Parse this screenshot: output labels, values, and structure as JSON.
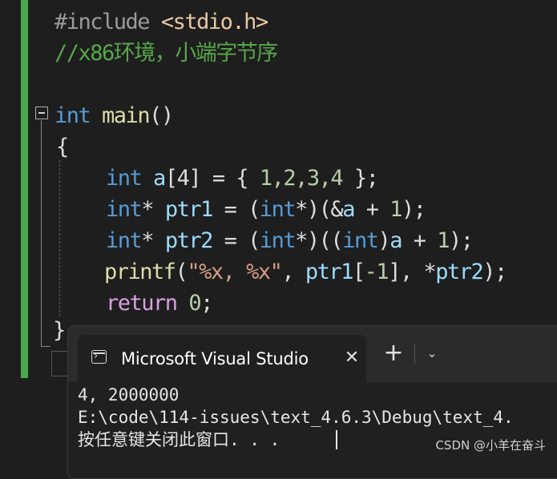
{
  "editor": {
    "line1": {
      "directive": "#include",
      "header": "<stdio.h>"
    },
    "line2": {
      "comment": "//x86环境，小端字节序"
    },
    "line4": {
      "type": "int",
      "name": "main",
      "parens": "()"
    },
    "line5": {
      "brace": "{"
    },
    "line6": {
      "type": "int",
      "var": "a",
      "rest": "[4] = { ",
      "nums": "1,2,3,4",
      "end": " };"
    },
    "line7": {
      "type": "int",
      "ptr": "*",
      "var": "ptr1",
      "eq": " = (",
      "cast": "int",
      "mid": "*)(&",
      "a": "a",
      "plus": " + ",
      "one": "1",
      "end": ");"
    },
    "line8": {
      "type": "int",
      "ptr": "*",
      "var": "ptr2",
      "eq": " = (",
      "cast": "int",
      "mid": "*)((",
      "cast2": "int",
      "close": ")",
      "a": "a",
      "plus": " + ",
      "one": "1",
      "end": ");"
    },
    "line9": {
      "fn": "printf",
      "open": "(",
      "fmt": "\"%x, %x\"",
      "comma": ", ",
      "p1": "ptr1",
      "idx_open": "[",
      "idx": "-1",
      "idx_close": "], *",
      "p2": "ptr2",
      "end": ");"
    },
    "line10": {
      "ret": "return",
      "sp": " ",
      "zero": "0",
      "semi": ";"
    },
    "line11": {
      "brace": "}"
    }
  },
  "terminal": {
    "tab_title": "Microsoft Visual Studio",
    "close_glyph": "✕",
    "new_tab_glyph": "+",
    "dropdown_glyph": "⌄",
    "output": [
      "4, 2000000",
      "E:\\code\\114-issues\\text_4.6.3\\Debug\\text_4.",
      "按任意键关闭此窗口. . ."
    ]
  },
  "watermark": "CSDN @小羊在奋斗",
  "colors": {
    "keyword": "#569cd6",
    "comment": "#57a64a",
    "variable": "#9cdcfe",
    "number": "#b5cea8",
    "function": "#dcdcaa",
    "string": "#d69d85",
    "control": "#d8a0df",
    "change_bar": "#4ca84c"
  }
}
